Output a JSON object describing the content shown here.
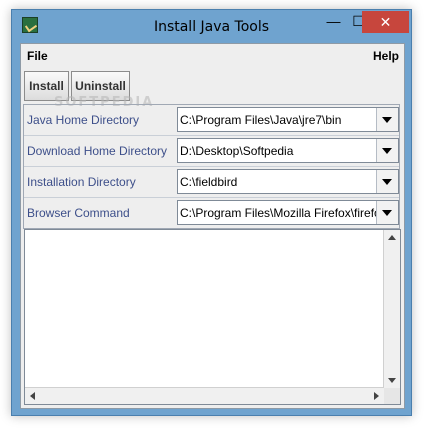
{
  "window": {
    "title": "Install Java Tools",
    "minimize_glyph": "—",
    "maximize_glyph": "☐",
    "close_glyph": "✕"
  },
  "menu": {
    "file": "File",
    "help": "Help"
  },
  "toolbar": {
    "install_label": "Install",
    "uninstall_label": "Uninstall"
  },
  "watermark": "SOFTPEDIA",
  "form": {
    "rows": [
      {
        "label": "Java Home Directory",
        "value": "C:\\Program Files\\Java\\jre7\\bin"
      },
      {
        "label": "Download Home Directory",
        "value": "D:\\Desktop\\Softpedia"
      },
      {
        "label": "Installation Directory",
        "value": "C:\\fieldbird"
      },
      {
        "label": "Browser Command",
        "value": "C:\\Program Files\\Mozilla Firefox\\firefox.exe"
      }
    ]
  },
  "output": {
    "text": ""
  },
  "icons": {
    "app": "java-app-icon",
    "combo_arrow": "chevron-down-icon"
  }
}
